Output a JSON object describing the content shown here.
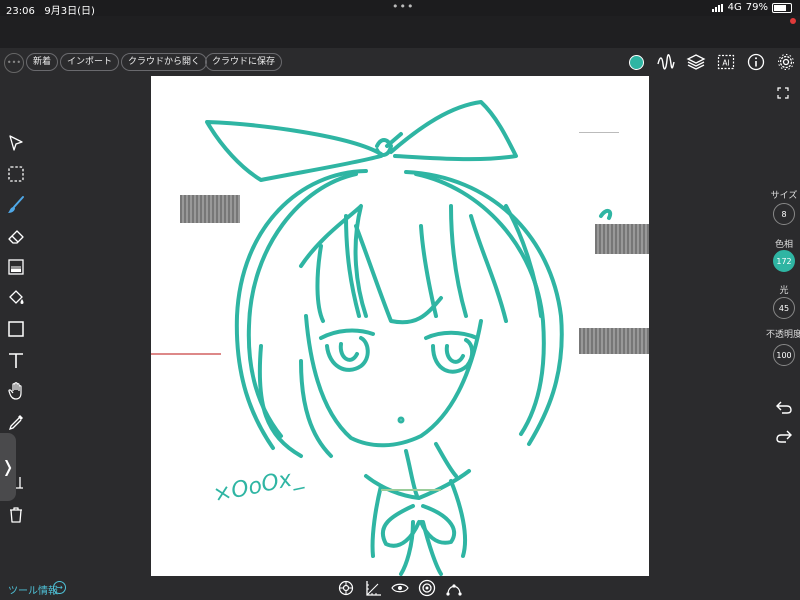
{
  "status_bar": {
    "time": "23:06",
    "date": "9月3日(日)",
    "center_indicator": "•••",
    "network": "4G",
    "battery": "79%"
  },
  "toolbar": {
    "menu_glyph": "•••",
    "buttons": [
      "新着",
      "インポート",
      "クラウドから開く",
      "クラウドに保存"
    ],
    "current_color": "#2fb5a3",
    "right_icons": [
      "color-swatch",
      "stroke-icon",
      "layers-icon",
      "ai-icon",
      "info-icon",
      "gear-icon"
    ]
  },
  "left_tools": [
    "select-arrow-icon",
    "marquee-select-icon",
    "brush-icon",
    "eraser-icon",
    "gradient-icon",
    "fill-bucket-icon",
    "rectangle-icon",
    "text-icon",
    "hand-icon",
    "eyedropper-icon",
    "transform-icon",
    "trash-icon"
  ],
  "properties": {
    "size_label": "サイズ",
    "size_value": "8",
    "hue_label": "色相",
    "hue_value": "172",
    "light_label": "光",
    "light_value": "45",
    "opacity_label": "不透明度",
    "opacity_value": "100"
  },
  "bottom": {
    "tool_info": "ツール情報",
    "icons": [
      "symmetry-icon",
      "ruler-icon",
      "eye-icon",
      "target-icon",
      "bezier-icon"
    ]
  },
  "drawing": {
    "signature": "×OoOx_",
    "stroke_color": "#2fb5a3"
  },
  "colors": {
    "accent": "#2fb5a3",
    "link": "#4fc3d9"
  }
}
